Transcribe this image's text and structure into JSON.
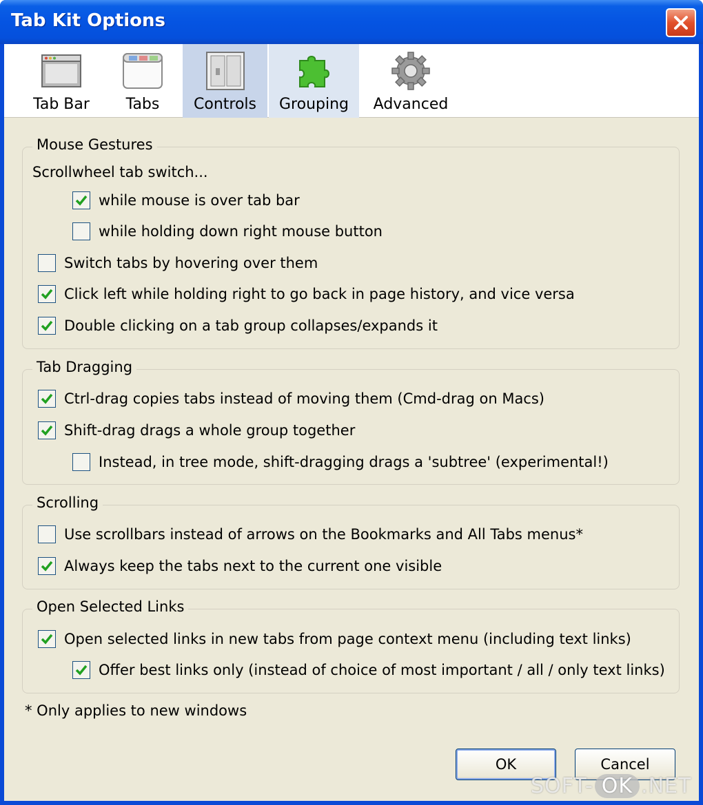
{
  "window": {
    "title": "Tab Kit Options"
  },
  "toolbar": {
    "tabs": [
      {
        "label": "Tab Bar",
        "icon": "tab-bar-icon"
      },
      {
        "label": "Tabs",
        "icon": "tabs-icon"
      },
      {
        "label": "Controls",
        "icon": "controls-icon",
        "selected": true
      },
      {
        "label": "Grouping",
        "icon": "puzzle-icon"
      },
      {
        "label": "Advanced",
        "icon": "gear-icon"
      }
    ]
  },
  "mouse_gestures": {
    "legend": "Mouse Gestures",
    "scroll_label": "Scrollwheel tab switch...",
    "options": [
      {
        "label": "while mouse is over tab bar",
        "checked": true
      },
      {
        "label": "while holding down right mouse button",
        "checked": false
      },
      {
        "label": "Switch tabs by hovering over them",
        "checked": false
      },
      {
        "label": "Click left while holding right to go back in page history, and vice versa",
        "checked": true
      },
      {
        "label": "Double clicking on a tab group collapses/expands it",
        "checked": true
      }
    ]
  },
  "tab_dragging": {
    "legend": "Tab Dragging",
    "options": [
      {
        "label": "Ctrl-drag copies tabs instead of moving them (Cmd-drag on Macs)",
        "checked": true
      },
      {
        "label": "Shift-drag drags a whole group together",
        "checked": true
      },
      {
        "label": "Instead, in tree mode, shift-dragging drags a 'subtree' (experimental!)",
        "checked": false
      }
    ]
  },
  "scrolling": {
    "legend": "Scrolling",
    "options": [
      {
        "label": "Use scrollbars instead of arrows on the Bookmarks and All Tabs menus*",
        "checked": false
      },
      {
        "label": "Always keep the tabs next to the current one visible",
        "checked": true
      }
    ]
  },
  "open_links": {
    "legend": "Open Selected Links",
    "options": [
      {
        "label": "Open selected links in new tabs from page context menu (including text links)",
        "checked": true
      },
      {
        "label": "Offer best links only (instead of choice of most important / all / only text links)",
        "checked": true
      }
    ]
  },
  "footnote": "* Only applies to new windows",
  "buttons": {
    "ok": "OK",
    "cancel": "Cancel"
  },
  "watermark": {
    "left": "SOFT-",
    "pill": "OK",
    "right": ".NET"
  },
  "colors": {
    "titlebar": "#0554e2",
    "dialog_bg": "#ece9d8",
    "check": "#21a121",
    "selected_tab": "#c8d5ea"
  }
}
